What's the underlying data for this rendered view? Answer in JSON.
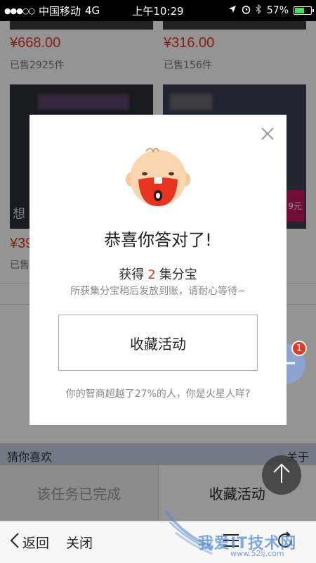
{
  "status_bar": {
    "signal": "●●●○○",
    "carrier": "中国移动",
    "network": "4G",
    "time": "上午10:29",
    "battery_percent": "57%",
    "battery_level": 0.57
  },
  "products": {
    "item1": {
      "price": "¥668.00",
      "sold": "已售2925件"
    },
    "item2": {
      "price": "¥316.00",
      "sold": "已售156件"
    },
    "item3": {
      "price_partial": "¥39",
      "sold_partial": "已售",
      "img_text": "想"
    },
    "item4": {
      "badge": "9元"
    }
  },
  "like_section": {
    "title": "猜你喜欢",
    "more": "关于"
  },
  "bottom_actions": {
    "done_label": "该任务已完成",
    "fav_label": "收藏活动"
  },
  "fab": {
    "badge_count": "1"
  },
  "modal": {
    "title": "恭喜你答对了!",
    "reward_prefix": "获得",
    "reward_count": "2",
    "reward_suffix": "集分宝",
    "reward_note": "所获集分宝稍后发放到账，请耐心等待~",
    "button_label": "收藏活动",
    "iq_note": "你的智商超越了27%的人，你是火星人咩?"
  },
  "nav": {
    "back_label": "返回",
    "close_label": "关闭"
  },
  "watermark": {
    "text": "我爱IT技术网",
    "url": "www.52ij.com"
  },
  "colors": {
    "accent_red": "#e8341f",
    "fab_blue": "#8ca8d6"
  },
  "icons": [
    "close-icon",
    "mascot-icon",
    "back-chevron-icon",
    "menu-icon",
    "refresh-icon",
    "plus-icon",
    "arrow-up-icon"
  ]
}
